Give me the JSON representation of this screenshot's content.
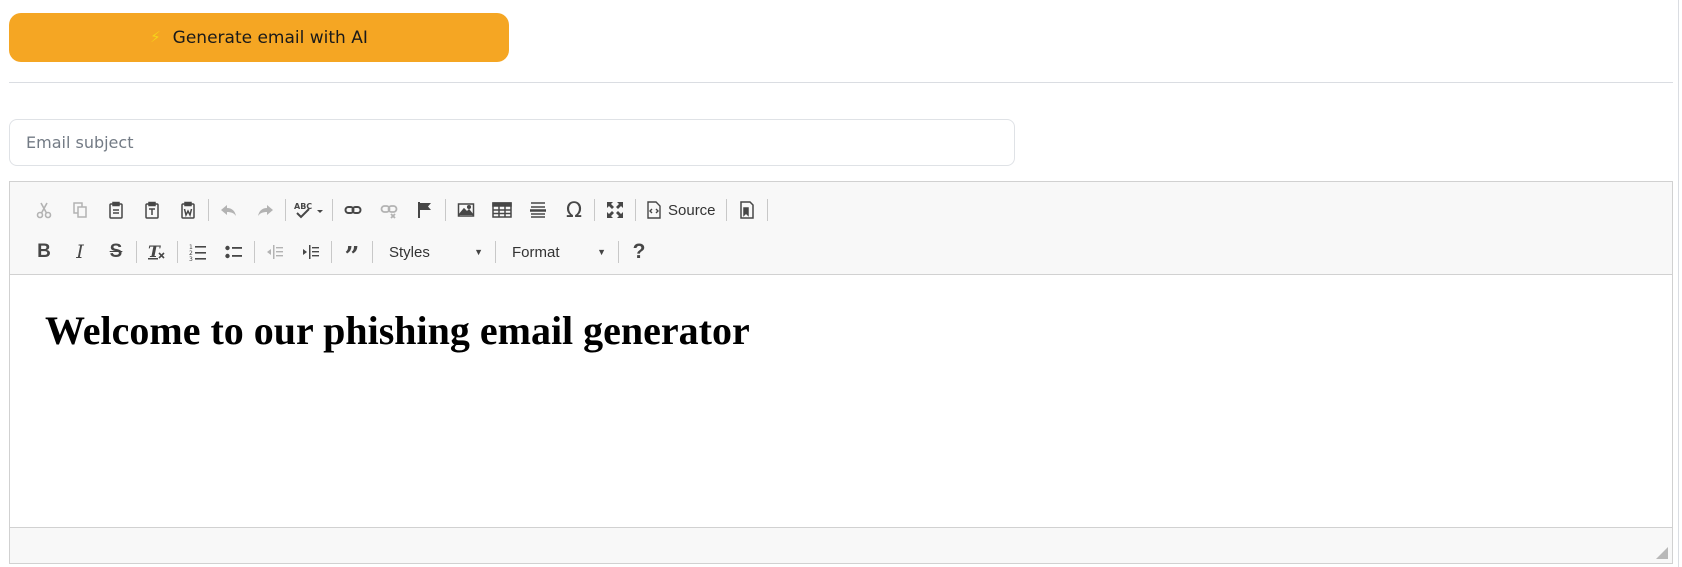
{
  "generate_button": {
    "label": "Generate email with AI",
    "icon": "lightning-icon",
    "color": "#f5a623"
  },
  "subject": {
    "placeholder": "Email subject",
    "value": ""
  },
  "toolbar": {
    "row1": [
      "cut-icon",
      "copy-icon",
      "paste-icon",
      "paste-text-icon",
      "paste-word-icon",
      "undo-icon",
      "redo-icon",
      "spellcheck-icon",
      "link-icon",
      "unlink-icon",
      "anchor-icon",
      "image-icon",
      "table-icon",
      "horizontal-line-icon",
      "special-char-icon",
      "maximize-icon",
      "source-icon",
      "template-icon"
    ],
    "source_label": "Source",
    "styles_label": "Styles",
    "format_label": "Format",
    "help_label": "?"
  },
  "content": {
    "heading": "Welcome to our phishing email generator"
  }
}
